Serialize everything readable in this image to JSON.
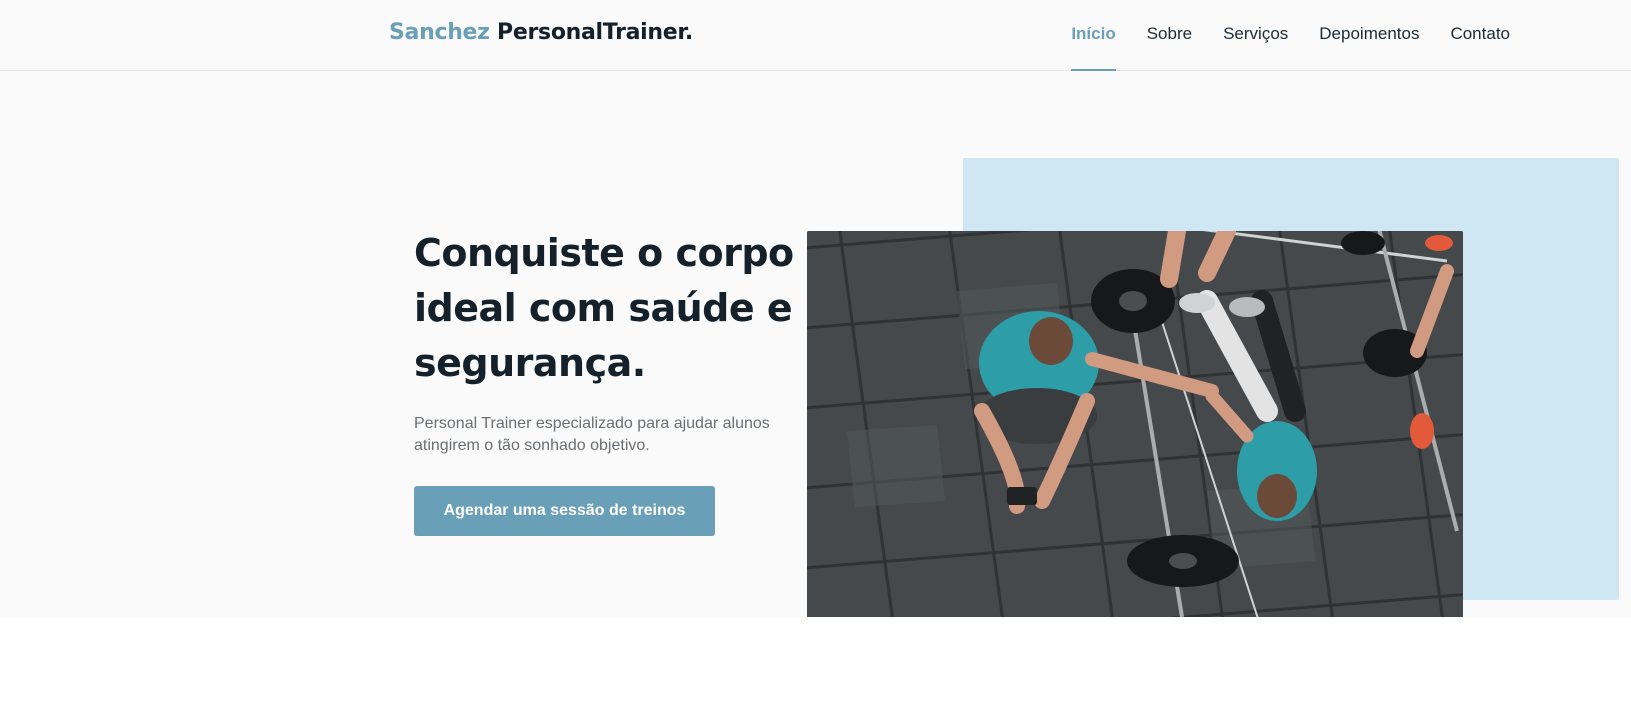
{
  "header": {
    "logo_accent": "Sanchez",
    "logo_main": "PersonalTrainer."
  },
  "nav": {
    "items": [
      {
        "label": "Início",
        "active": true
      },
      {
        "label": "Sobre",
        "active": false
      },
      {
        "label": "Serviços",
        "active": false
      },
      {
        "label": "Depoimentos",
        "active": false
      },
      {
        "label": "Contato",
        "active": false
      }
    ]
  },
  "hero": {
    "title": "Conquiste o corpo ideal com saúde e segurança.",
    "subtitle": "Personal Trainer especializado para ajudar alunos atingirem o tão sonhado objetivo.",
    "cta_label": "Agendar uma sessão de treinos"
  },
  "colors": {
    "accent": "#6a9fb8",
    "dark_text": "#14212b",
    "light_blue_block": "#cfe6f3",
    "background": "#fafafa"
  }
}
